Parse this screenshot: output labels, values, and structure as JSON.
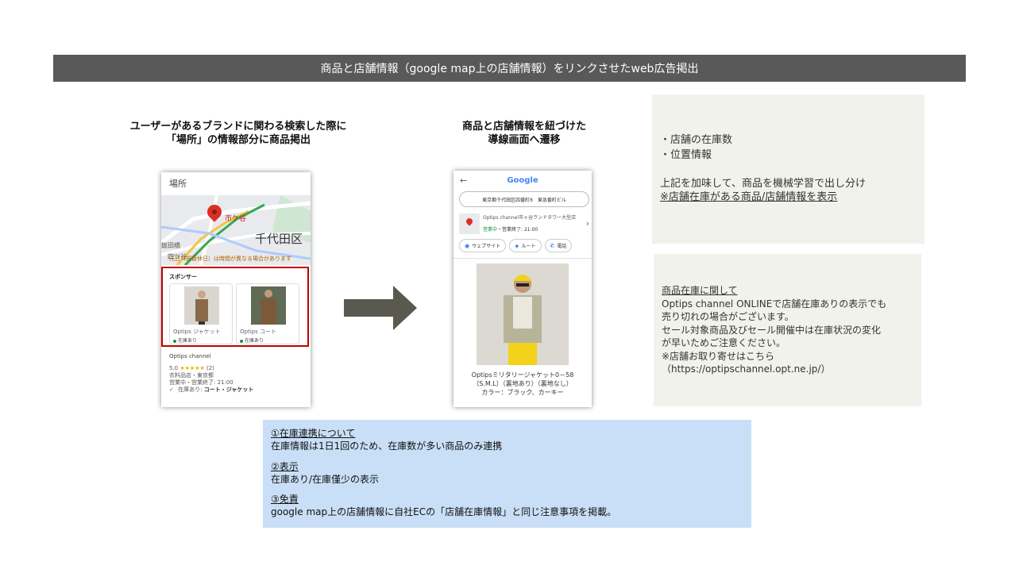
{
  "banner": {
    "title": "商品と店舗情報（google map上の店舗情報）をリンクさせたweb広告掲出"
  },
  "left_heading": {
    "line1": "ユーザーがあるブランドに関わる検索した際に",
    "line2": "「場所」の情報部分に商品掲出"
  },
  "mid_heading": {
    "line1": "商品と店舗情報を紐づけた",
    "line2": "導線画面へ遷移"
  },
  "phone1": {
    "title": "場所",
    "map_labels": {
      "pin": "市ケ谷",
      "district": "千代田区",
      "left1": "飯田橋",
      "left2": "四ツ谷"
    },
    "notice": "元日（振替休日）は時間が異なる場合があります",
    "sponsor_label": "スポンサー",
    "cards": [
      {
        "title": "Optips ジャケット",
        "stock": "在庫あり"
      },
      {
        "title": "Optips コート",
        "stock": "在庫あり"
      }
    ],
    "store_name": "Optips channel",
    "rating": "5.0",
    "stars": "★★★★★",
    "review_count": "(2)",
    "category": "衣料品店・東京都",
    "hours": "営業中・営業終了: 21:00",
    "in_stock_label": "在庫あり:",
    "in_stock_items": "コート・ジャケット"
  },
  "phone2": {
    "back": "←",
    "logo": "Google",
    "search": "東京都千代田区四番町6　東急番町ビル",
    "store_line": "Optips channel市ヶ谷ランドタワー大型店",
    "open_status": "営業中",
    "open_hours": "・営業終了: 21:00",
    "chips": [
      "ウェブサイト",
      "ルート",
      "電話"
    ],
    "product_lines": [
      "Optipsミリタリージャケット0－58",
      "（S.M.L）（裏地あり）（裏地なし）",
      "カラー：ブラック、カーキー"
    ]
  },
  "right_box1": {
    "bullets": [
      "・店舗の在庫数",
      "・位置情報"
    ],
    "line1": "上記を加味して、商品を機械学習で出し分け",
    "line2": "※店舗在庫がある商品/店舗情報を表示"
  },
  "right_box2": {
    "heading": "商品在庫に関して",
    "lines": [
      "Optips channel ONLINEで店舗在庫ありの表示でも",
      "売り切れの場合がございます。",
      "セール対象商品及びセール開催中は在庫状況の変化",
      "が早いためご注意ください。",
      "※店舗お取り寄せはこちら",
      "（https://optipschannel.opt.ne.jp/）"
    ]
  },
  "bottom_box": {
    "sections": [
      {
        "heading": "①在庫連携について",
        "body": "在庫情報は1日1回のため、在庫数が多い商品のみ連携"
      },
      {
        "heading": "②表示",
        "body": "在庫あり/在庫僅少の表示"
      },
      {
        "heading": "③免責",
        "body": "google map上の店舗情報に自社ECの「店舗在庫情報」と同じ注意事項を掲載。"
      }
    ]
  },
  "colors": {
    "banner": "#595959",
    "highlight_border": "#c00000",
    "note_box": "#f2f2ec",
    "blue_box": "#c9dff7",
    "arrow": "#595950"
  }
}
